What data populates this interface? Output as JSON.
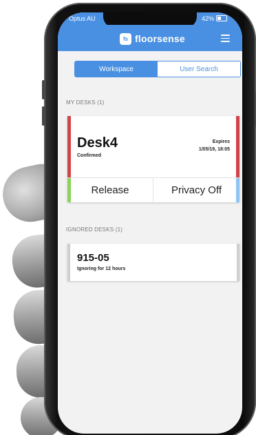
{
  "status_bar": {
    "carrier": "Optus AU",
    "battery": "42%"
  },
  "header": {
    "logo_badge": "fs",
    "brand": "floorsense"
  },
  "tabs": [
    {
      "label": "Workspace",
      "active": true
    },
    {
      "label": "User Search",
      "active": false
    }
  ],
  "my_desks": {
    "section_label": "MY DESKS (1)",
    "desk": {
      "name": "Desk4",
      "status": "Confirmed",
      "expires_label": "Expires",
      "expires_value": "1/05/19, 18:05",
      "release_label": "Release",
      "privacy_label": "Privacy Off"
    }
  },
  "ignored_desks": {
    "section_label": "IGNORED DESKS (1)",
    "desk": {
      "name": "915-05",
      "status": "Ignoring for 12 hours"
    }
  },
  "colors": {
    "brand_blue": "#4a90e2",
    "status_red": "#d1434b",
    "release_green": "#8bd25a",
    "privacy_blue": "#8ec4f5",
    "ignored_gray": "#cfcfcf"
  },
  "icons": {
    "menu": "hamburger-menu-icon",
    "battery": "battery-icon"
  }
}
